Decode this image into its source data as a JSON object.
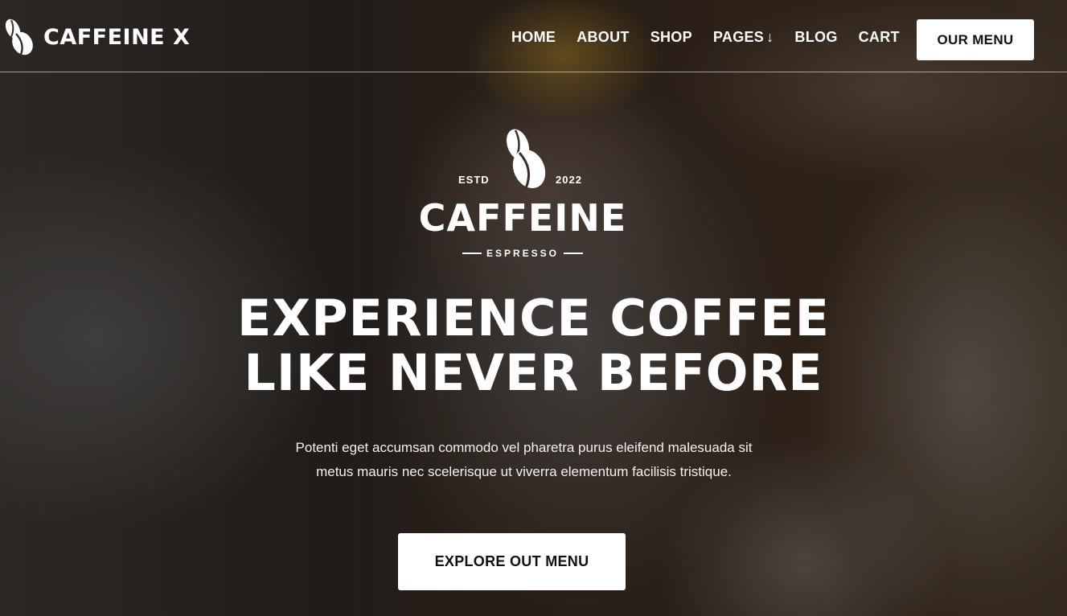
{
  "brand": {
    "name": "CAFFEINE X",
    "icon": "coffee-bean-icon"
  },
  "nav": {
    "items": [
      {
        "label": "HOME"
      },
      {
        "label": "ABOUT"
      },
      {
        "label": "SHOP"
      },
      {
        "label": "PAGES",
        "arrow": "↓"
      },
      {
        "label": "BLOG"
      },
      {
        "label": "CART"
      }
    ],
    "cta_label": "OUR MENU"
  },
  "hero": {
    "logo": {
      "estd": "ESTD",
      "year": "2022",
      "word": "CAFFEINE",
      "sub": "ESPRESSO",
      "icon": "coffee-beans-icon"
    },
    "headline_line1": "EXPERIENCE COFFEE",
    "headline_line2": "LIKE NEVER BEFORE",
    "subtext_line1": "Potenti eget accumsan commodo vel pharetra purus eleifend malesuada sit",
    "subtext_line2": "metus mauris nec scelerisque ut viverra elementum facilisis tristique.",
    "cta_label": "EXPLORE OUT MENU"
  },
  "colors": {
    "button_bg": "#ffffff",
    "button_text": "#111111",
    "text": "#ffffff"
  }
}
